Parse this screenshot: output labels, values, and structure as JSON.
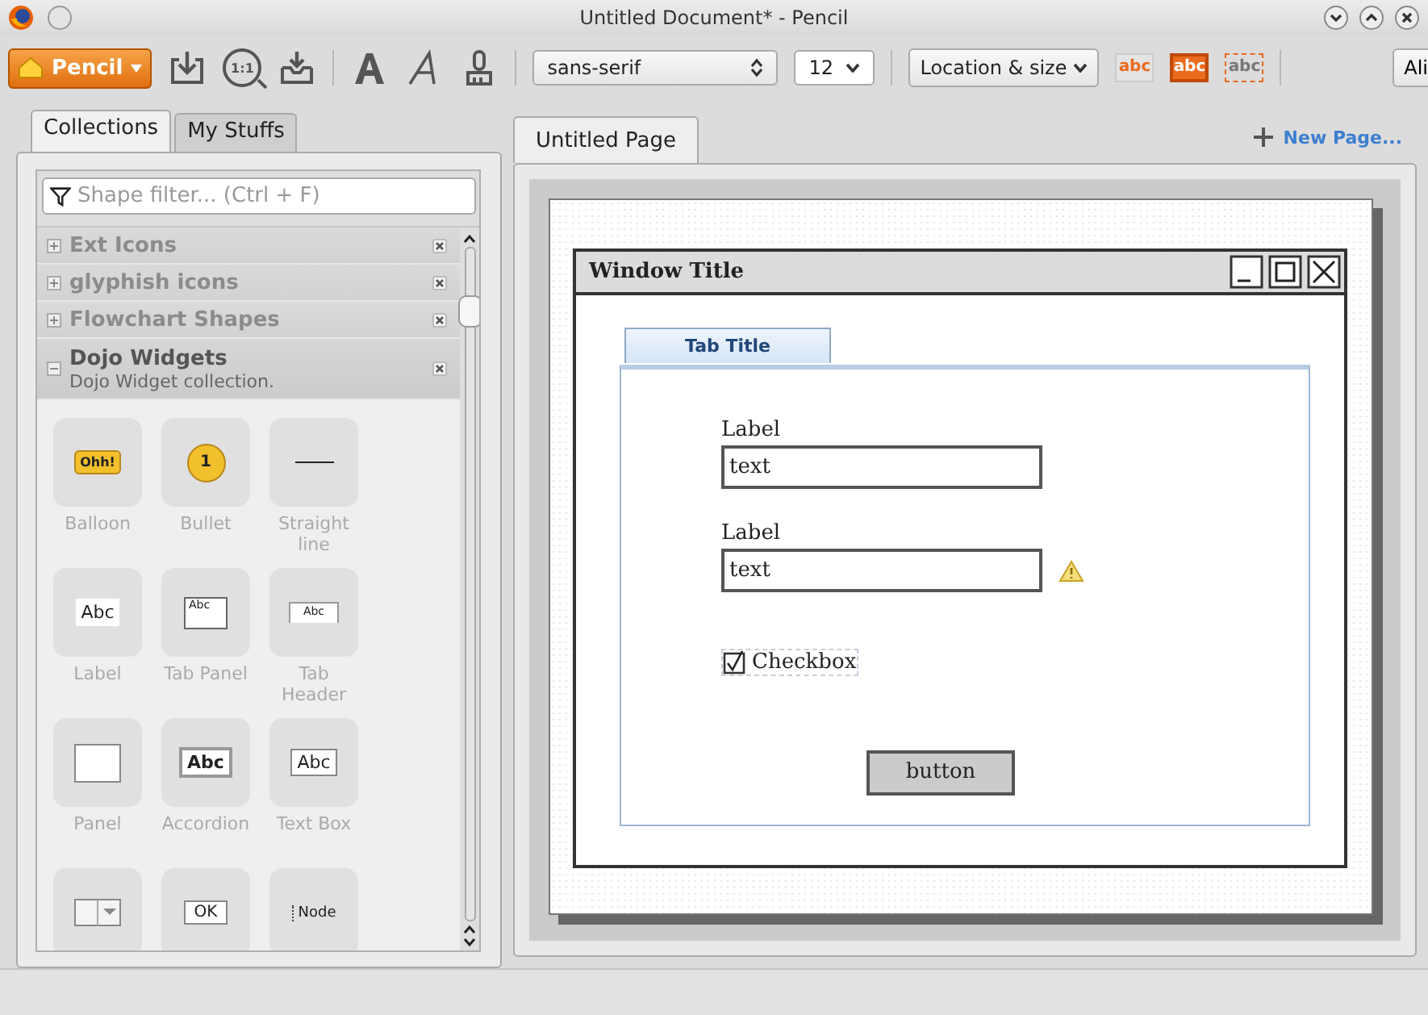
{
  "window": {
    "title": "Untitled Document* - Pencil"
  },
  "toolbar": {
    "app_button": "Pencil",
    "zoom_label": "1:1",
    "font_family": "sans-serif",
    "font_size": "12",
    "location_menu": "Location & size",
    "align_button": "Ali",
    "style_presets": [
      {
        "label": "abc",
        "kind": "outline"
      },
      {
        "label": "abc",
        "kind": "filled"
      },
      {
        "label": "abc",
        "kind": "dashed"
      }
    ]
  },
  "sidebar": {
    "tabs": [
      {
        "label": "Collections",
        "selected": true
      },
      {
        "label": "My Stuffs",
        "selected": false
      }
    ],
    "filter": {
      "placeholder": "Shape filter... (Ctrl + F)"
    },
    "collections": [
      {
        "name": "Ext Icons",
        "expanded": false
      },
      {
        "name": "glyphish icons",
        "expanded": false
      },
      {
        "name": "Flowchart Shapes",
        "expanded": false
      },
      {
        "name": "Dojo Widgets",
        "description": "Dojo Widget collection.",
        "expanded": true
      }
    ],
    "shapes": [
      {
        "kind": "balloon",
        "label": "Balloon",
        "icon_text": "Ohh!"
      },
      {
        "kind": "bullet",
        "label": "Bullet",
        "icon_text": "1"
      },
      {
        "kind": "line",
        "label": "Straight line"
      },
      {
        "kind": "label",
        "label": "Label",
        "icon_text": "Abc"
      },
      {
        "kind": "tabpanel",
        "label": "Tab Panel",
        "icon_text": "Abc"
      },
      {
        "kind": "tabheader",
        "label": "Tab Header",
        "icon_text": "Abc"
      },
      {
        "kind": "panel",
        "label": "Panel"
      },
      {
        "kind": "accordion",
        "label": "Accordion",
        "icon_text": "Abc"
      },
      {
        "kind": "textbox",
        "label": "Text Box",
        "icon_text": "Abc"
      },
      {
        "kind": "combo"
      },
      {
        "kind": "button",
        "icon_text": "OK"
      },
      {
        "kind": "node",
        "icon_text": "Node"
      }
    ]
  },
  "pages": {
    "tabs": [
      {
        "label": "Untitled Page",
        "selected": true
      }
    ],
    "new_page": "New Page..."
  },
  "mockup": {
    "window_title": "Window Title",
    "tab_title": "Tab Title",
    "fields": [
      {
        "label": "Label",
        "value": "text",
        "warning": false
      },
      {
        "label": "Label",
        "value": "text",
        "warning": true
      }
    ],
    "checkbox": {
      "label": "Checkbox",
      "checked": true
    },
    "button": "button"
  }
}
